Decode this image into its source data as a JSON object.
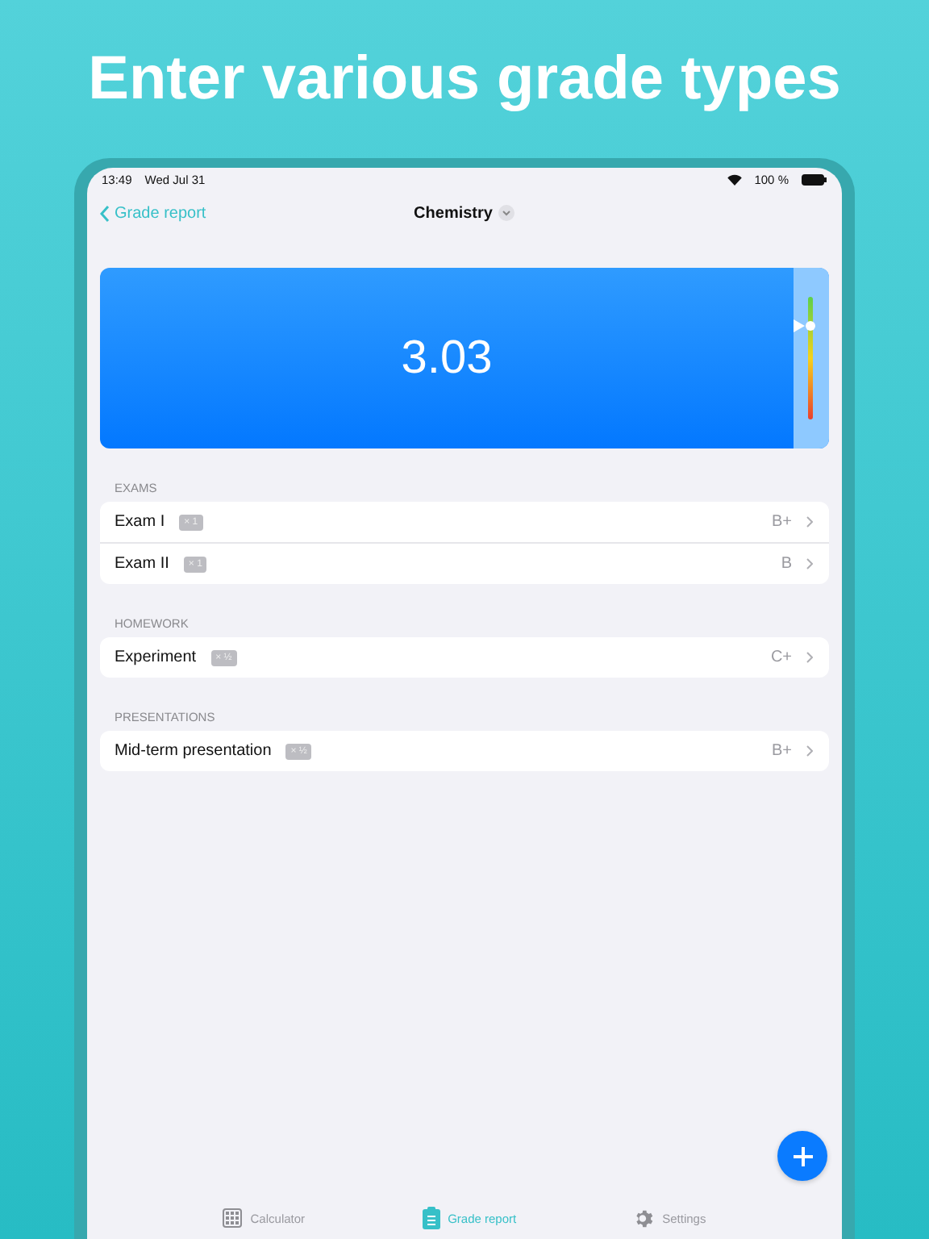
{
  "headline": "Enter various grade types",
  "status_bar": {
    "time": "13:49",
    "date": "Wed Jul 31",
    "battery": "100 %"
  },
  "nav": {
    "back": "Grade report",
    "title": "Chemistry"
  },
  "grade_card": {
    "average": "3.03",
    "level": 0.76
  },
  "sections": [
    {
      "title": "EXAMS",
      "rows": [
        {
          "name": "Exam I",
          "weight": "× 1",
          "grade": "B+"
        },
        {
          "name": "Exam II",
          "weight": "× 1",
          "grade": "B"
        }
      ]
    },
    {
      "title": "HOMEWORK",
      "rows": [
        {
          "name": "Experiment",
          "weight": "× ½",
          "grade": "C+"
        }
      ]
    },
    {
      "title": "PRESENTATIONS",
      "rows": [
        {
          "name": "Mid-term presentation",
          "weight": "× ½",
          "grade": "B+"
        }
      ]
    }
  ],
  "tabs": [
    {
      "label": "Calculator",
      "kind": "calculator",
      "selected": false
    },
    {
      "label": "Grade report",
      "kind": "report",
      "selected": true
    },
    {
      "label": "Settings",
      "kind": "settings",
      "selected": false
    }
  ]
}
